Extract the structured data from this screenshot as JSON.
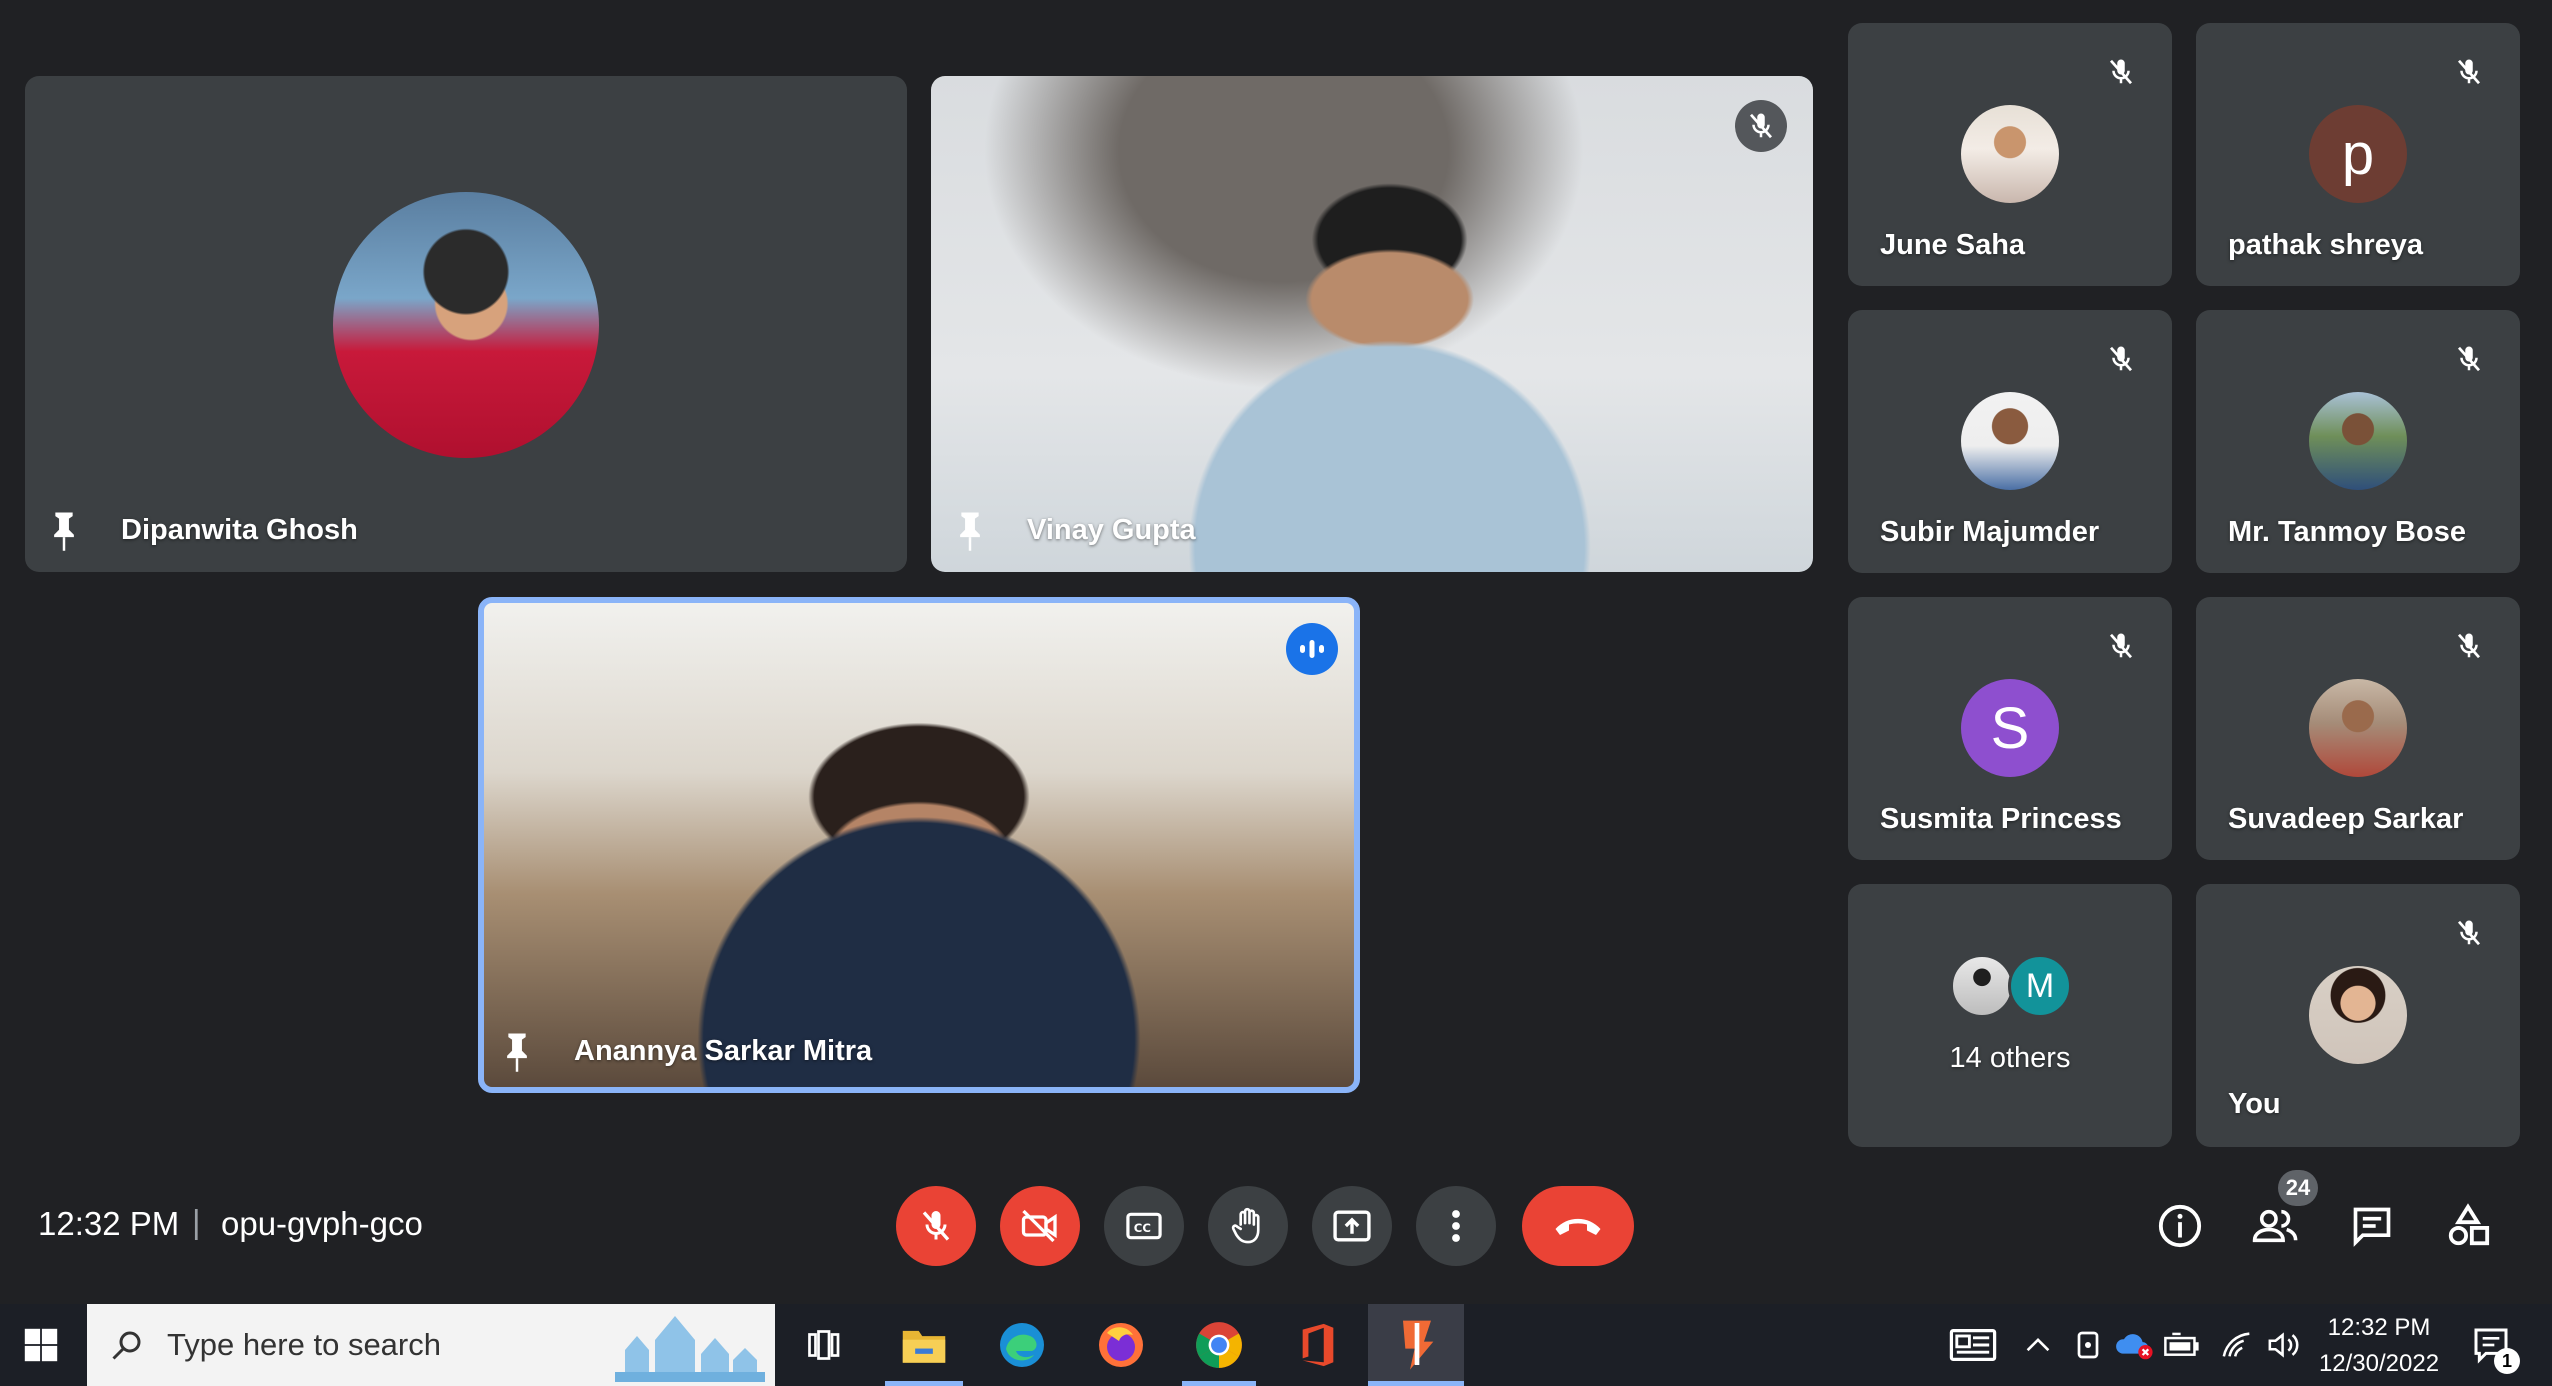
{
  "meeting": {
    "time": "12:32 PM",
    "separator": "|",
    "code": "opu-gvph-gco"
  },
  "main_tiles": [
    {
      "name": "Dipanwita Ghosh"
    },
    {
      "name": "Vinay Gupta"
    },
    {
      "name": "Anannya Sarkar Mitra"
    }
  ],
  "side_tiles": [
    {
      "name": "June Saha"
    },
    {
      "name": "pathak shreya",
      "letter": "p"
    },
    {
      "name": "Subir Majumder"
    },
    {
      "name": "Mr. Tanmoy Bose"
    },
    {
      "name": "Susmita Princess",
      "letter": "S"
    },
    {
      "name": "Suvadeep Sarkar"
    },
    {
      "name": "14 others",
      "letter": "M"
    },
    {
      "name": "You"
    }
  ],
  "controls": {
    "people_count": "24"
  },
  "taskbar": {
    "search_placeholder": "Type here to search",
    "clock_time": "12:32 PM",
    "clock_date": "12/30/2022",
    "notification_count": "1"
  },
  "colors": {
    "background": "#202124",
    "tile": "#3c4043",
    "danger": "#ea4335",
    "speaking_border": "#8ab4f8",
    "pathak_avatar": "#6d3d33",
    "susmita_avatar": "#8e4fcf",
    "m_avatar": "#12939a"
  }
}
